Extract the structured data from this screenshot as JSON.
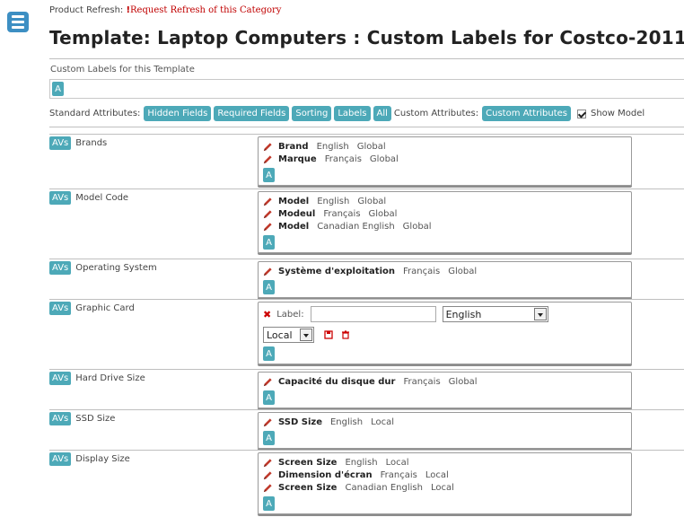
{
  "refresh": {
    "prefix": "Product Refresh:",
    "bang": "!",
    "link": "Request Refresh of this Category"
  },
  "title": "Template: Laptop Computers : Custom Labels for Costco-2011",
  "custom_labels": {
    "heading": "Custom Labels for this Template",
    "add_button": "A"
  },
  "attributes_bar": {
    "standard_label": "Standard Attributes:",
    "standard_buttons": [
      "Hidden Fields",
      "Required Fields",
      "Sorting",
      "Labels",
      "All"
    ],
    "custom_label": "Custom Attributes:",
    "custom_button": "Custom Attributes",
    "show_model_label": "Show Model",
    "show_model_checked": true
  },
  "rows": [
    {
      "avs": "AVs",
      "name": "Brands",
      "labels": [
        {
          "text": "Brand",
          "lang": "English",
          "scope": "Global"
        },
        {
          "text": "Marque",
          "lang": "Français",
          "scope": "Global"
        }
      ],
      "add": "A"
    },
    {
      "avs": "AVs",
      "name": "Model Code",
      "labels": [
        {
          "text": "Model",
          "lang": "English",
          "scope": "Global"
        },
        {
          "text": "Modeul",
          "lang": "Français",
          "scope": "Global"
        },
        {
          "text": "Model",
          "lang": "Canadian English",
          "scope": "Global"
        }
      ],
      "add": "A"
    },
    {
      "avs": "AVs",
      "name": "Operating System",
      "labels": [
        {
          "text": "Système d'exploitation",
          "lang": "Français",
          "scope": "Global"
        }
      ],
      "add": "A"
    },
    {
      "avs": "AVs",
      "name": "Graphic Card",
      "edit": {
        "label_prompt": "Label:",
        "label_value": "",
        "language_selected": "English",
        "scope_selected": "Local"
      },
      "add": "A"
    },
    {
      "avs": "AVs",
      "name": "Hard Drive Size",
      "labels": [
        {
          "text": "Capacité du disque dur",
          "lang": "Français",
          "scope": "Global"
        }
      ],
      "add": "A"
    },
    {
      "avs": "AVs",
      "name": "SSD Size",
      "labels": [
        {
          "text": "SSD Size",
          "lang": "English",
          "scope": "Local"
        }
      ],
      "add": "A"
    },
    {
      "avs": "AVs",
      "name": "Display Size",
      "labels": [
        {
          "text": "Screen Size",
          "lang": "English",
          "scope": "Local"
        },
        {
          "text": "Dimension d'écran",
          "lang": "Français",
          "scope": "Local"
        },
        {
          "text": "Screen Size",
          "lang": "Canadian English",
          "scope": "Local"
        }
      ],
      "add": "A"
    }
  ],
  "colors": {
    "accent": "#4da9b8",
    "menu": "#3d8fc3",
    "link_red": "#c00000"
  },
  "icons": {
    "menu": "hamburger-icon",
    "edit": "pencil-icon",
    "delete": "x-icon",
    "save": "floppy-icon",
    "trash": "trash-icon"
  }
}
